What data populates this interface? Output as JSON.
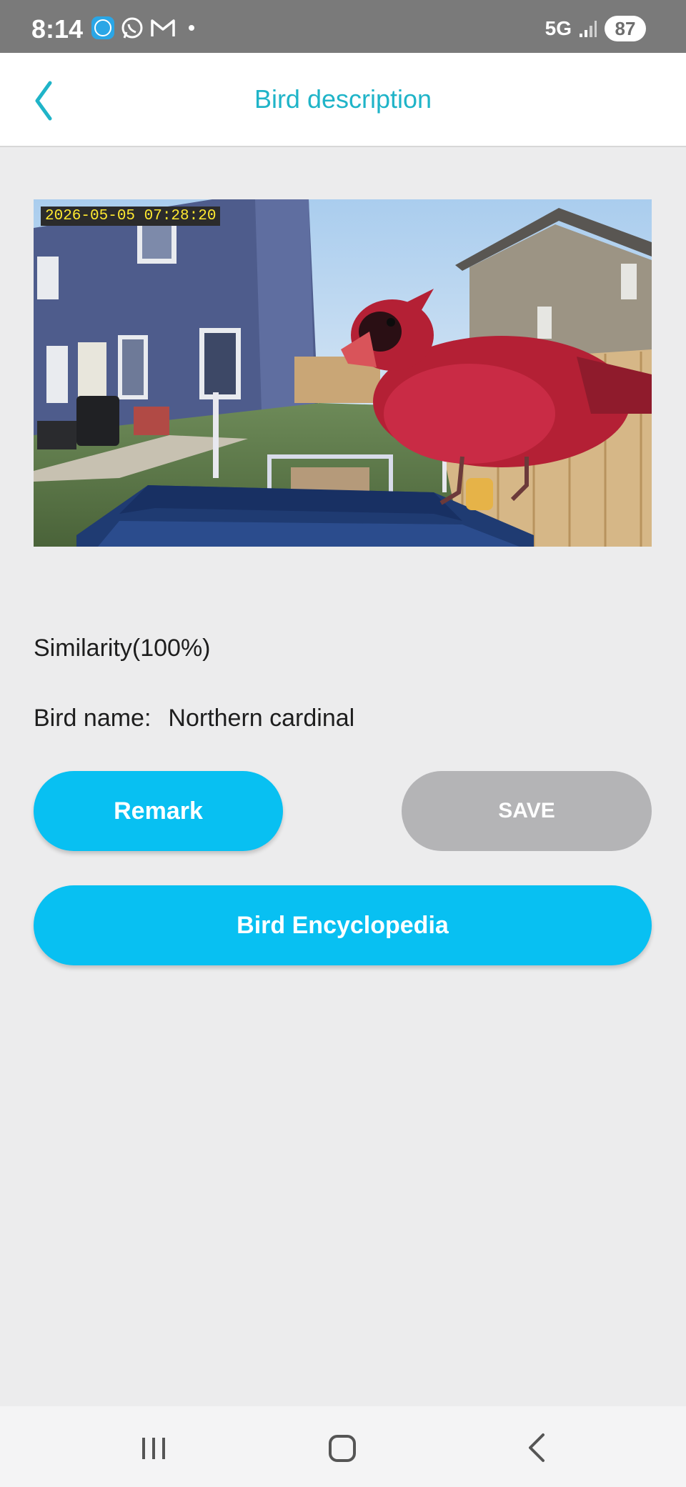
{
  "status_bar": {
    "time": "8:14",
    "app_icons": [
      "box-app-icon",
      "whatsapp-icon",
      "gmail-icon"
    ],
    "network": "5G",
    "battery": "87"
  },
  "header": {
    "title": "Bird description",
    "back_icon": "chevron-left-icon",
    "accent_color": "#1fb4c8"
  },
  "photo": {
    "timestamp": "2026-05-05 07:28:20"
  },
  "details": {
    "similarity": "Similarity(100%)",
    "bird_name_label": "Bird name:",
    "bird_name_value": "Northern cardinal"
  },
  "buttons": {
    "remark": "Remark",
    "save": "SAVE",
    "encyclopedia": "Bird Encyclopedia",
    "primary_color": "#08c0f2",
    "disabled_color": "#b4b4b6"
  },
  "nav_bar": {
    "icons": [
      "recent-apps-icon",
      "home-icon",
      "back-icon"
    ]
  }
}
